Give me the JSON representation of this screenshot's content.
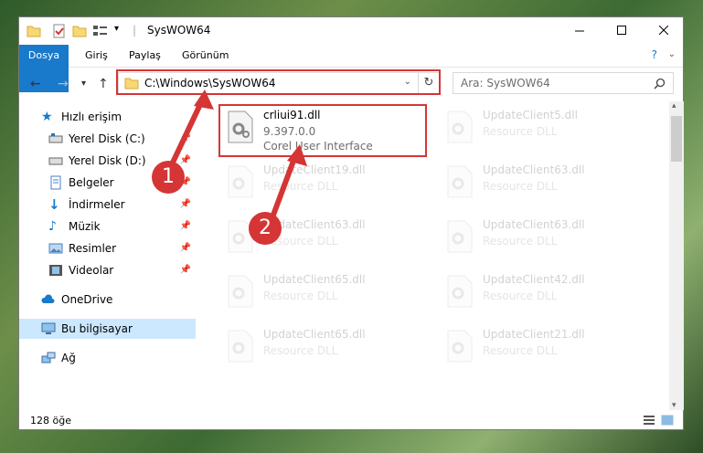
{
  "window": {
    "title": "SysWOW64"
  },
  "ribbon": {
    "tabs": [
      "Dosya",
      "Giriş",
      "Paylaş",
      "Görünüm"
    ]
  },
  "address": {
    "path": "C:\\Windows\\SysWOW64"
  },
  "search": {
    "placeholder": "Ara: SysWOW64"
  },
  "sidebar": {
    "items": [
      {
        "label": "Hızlı erişim"
      },
      {
        "label": "Yerel Disk (C:)"
      },
      {
        "label": "Yerel Disk (D:)"
      },
      {
        "label": "Belgeler"
      },
      {
        "label": "İndirmeler"
      },
      {
        "label": "Müzik"
      },
      {
        "label": "Resimler"
      },
      {
        "label": "Videolar"
      },
      {
        "label": "OneDrive"
      },
      {
        "label": "Bu bilgisayar"
      },
      {
        "label": "Ağ"
      }
    ]
  },
  "files": [
    {
      "name": "crliui91.dll",
      "version": "9.397.0.0",
      "desc": "Corel User Interface"
    },
    {
      "name": "UpdateClient5.dll",
      "desc": "Resource DLL"
    },
    {
      "name": "UpdateClient19.dll",
      "desc": "Resource DLL"
    },
    {
      "name": "UpdateClient63.dll",
      "desc": "Resource DLL"
    },
    {
      "name": "UpdateClient63.dll",
      "desc": "Resource DLL"
    },
    {
      "name": "UpdateClient63.dll",
      "desc": "Resource DLL"
    },
    {
      "name": "UpdateClient65.dll",
      "desc": "Resource DLL"
    },
    {
      "name": "UpdateClient42.dll",
      "desc": "Resource DLL"
    },
    {
      "name": "UpdateClient65.dll",
      "desc": "Resource DLL"
    },
    {
      "name": "UpdateClient21.dll",
      "desc": "Resource DLL"
    }
  ],
  "status": {
    "count": "128 öğe"
  },
  "callouts": [
    "1",
    "2"
  ],
  "colors": {
    "accent": "#1979ca",
    "highlight": "#d53535",
    "selected": "#cce8ff"
  }
}
